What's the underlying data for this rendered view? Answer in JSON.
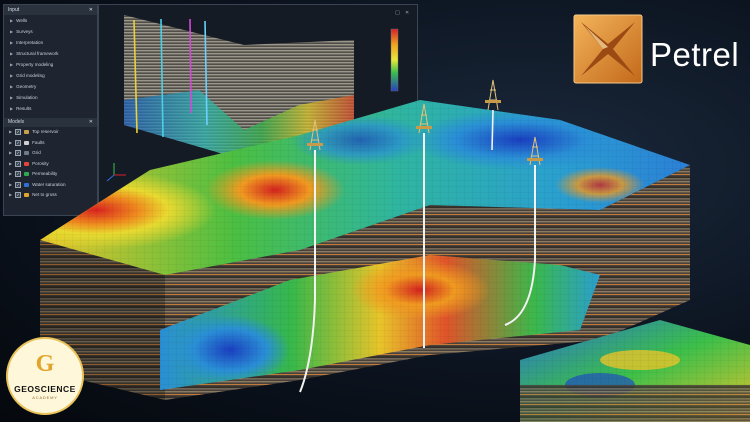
{
  "panel": {
    "title": "Input",
    "items": [
      "Wells",
      "Surveys",
      "Interpretation",
      "Structural framework",
      "Property modeling",
      "Grid modeling",
      "Geometry",
      "Simulation",
      "Results"
    ]
  },
  "models": {
    "title": "Models",
    "items": [
      {
        "label": "Top reservoir",
        "color": "#c9a04a"
      },
      {
        "label": "Faults",
        "color": "#d0d0d0"
      },
      {
        "label": "Grid",
        "color": "#6d7a88"
      },
      {
        "label": "Porosity",
        "color": "#e2453a"
      },
      {
        "label": "Permeability",
        "color": "#2fa84f"
      },
      {
        "label": "Water saturation",
        "color": "#2f6fd6"
      },
      {
        "label": "Net to gross",
        "color": "#e0a52a"
      }
    ]
  },
  "colorbar": {
    "labels": [
      "",
      "",
      "",
      "",
      ""
    ]
  },
  "brand": {
    "name": "Petrel"
  },
  "badge": {
    "monogram": "G",
    "name": "GEOSCIENCE",
    "sub": "ACADEMY"
  },
  "colors": {
    "accent": "#e08a1e",
    "panel": "#1e2530",
    "badge": "#e0a52a"
  }
}
